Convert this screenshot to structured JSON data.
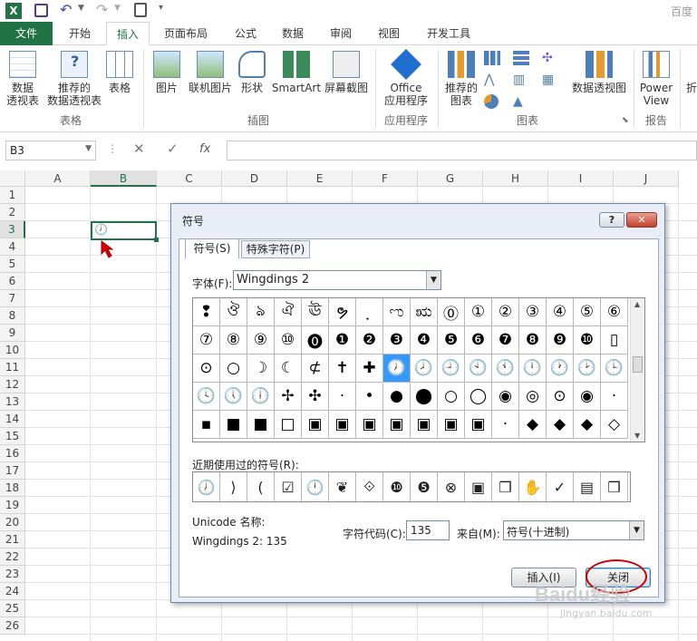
{
  "window": {
    "title_partial": "百度经"
  },
  "tabs": [
    "文件",
    "开始",
    "插入",
    "页面布局",
    "公式",
    "数据",
    "审阅",
    "视图",
    "开发工具"
  ],
  "ribbon": {
    "buttons": {
      "pivot": "数据\n透视表",
      "recommended_pivot": "推荐的\n数据透视表",
      "table": "表格",
      "pictures": "图片",
      "online_pictures": "联机图片",
      "shapes": "形状",
      "smartart": "SmartArt",
      "screenshot": "屏幕截图",
      "office_apps": "Office\n应用程序",
      "recommended_charts": "推荐的\n图表",
      "pivot_chart": "数据透视图",
      "power_view": "Power\nView",
      "more": "折"
    },
    "groups": {
      "tables": "表格",
      "illustrations": "插图",
      "apps": "应用程序",
      "charts": "图表",
      "reports": "报告"
    }
  },
  "formula_bar": {
    "name_box": "B3",
    "fx": "fx"
  },
  "grid": {
    "columns": [
      "A",
      "B",
      "C",
      "D",
      "E",
      "F",
      "G",
      "H",
      "I",
      "J"
    ],
    "rows": [
      "1",
      "2",
      "3",
      "4",
      "5",
      "6",
      "7",
      "8",
      "9",
      "10",
      "11",
      "12",
      "13",
      "14",
      "15",
      "16",
      "17",
      "18",
      "19",
      "20",
      "21",
      "22",
      "23",
      "24",
      "25",
      "26"
    ],
    "b3_value": "🕖"
  },
  "dialog": {
    "title": "符号",
    "help": "?",
    "close_x": "✕",
    "tab_symbols": "符号(S)",
    "tab_special": "特殊字符(P)",
    "font_label": "字体(F):",
    "font_value": "Wingdings 2",
    "symbols": [
      [
        "❢",
        "ঔ",
        "ঌ",
        "ঐ",
        "ঊ",
        "ຯ",
        "ฺ",
        "ಌ",
        "ಋ",
        "⓪",
        "①",
        "②",
        "③",
        "④",
        "⑤",
        "⑥"
      ],
      [
        "⑦",
        "⑧",
        "⑨",
        "⑩",
        "⓿",
        "❶",
        "❷",
        "❸",
        "❹",
        "❺",
        "❻",
        "❼",
        "❽",
        "❾",
        "❿",
        "▯"
      ],
      [
        "⊙",
        "○",
        "☽",
        "☾",
        "⊄",
        "✝",
        "✚",
        "🕖",
        "🕗",
        "🕘",
        "🕙",
        "🕚",
        "🕛",
        "🕐",
        "🕑",
        "🕒"
      ],
      [
        "🕓",
        "🕔",
        "🕕",
        "✢",
        "✣",
        "·",
        "•",
        "●",
        "⬤",
        "○",
        "◯",
        "◉",
        "◎",
        "⊙",
        "◉",
        "·"
      ],
      [
        "▪",
        "■",
        "■",
        "□",
        "▣",
        "▣",
        "▣",
        "▣",
        "▣",
        "▣",
        "▣",
        "·",
        "◆",
        "◆",
        "◆",
        "◇"
      ]
    ],
    "selected_index": [
      2,
      7
    ],
    "recent_label": "近期使用过的符号(R):",
    "recent": [
      "🕖",
      "⟩",
      "(",
      "☑",
      "🕛",
      "❦",
      "⟐",
      "❿",
      "❺",
      "⊗",
      "▣",
      "❒",
      "✋",
      "✓",
      "▤",
      "❒"
    ],
    "unicode_name_label": "Unicode 名称:",
    "unicode_name_value": "Wingdings 2: 135",
    "char_code_label": "字符代码(C):",
    "char_code_value": "135",
    "from_label": "来自(M):",
    "from_value": "符号(十进制)",
    "insert_button": "插入(I)",
    "close_button": "关闭"
  },
  "watermark": {
    "text1": "Baidu经验",
    "text2": "jingyan.baidu.com"
  },
  "colors": {
    "excel_green": "#217346",
    "selected_blue": "#3399ff",
    "annotation_red": "#cc0000"
  }
}
